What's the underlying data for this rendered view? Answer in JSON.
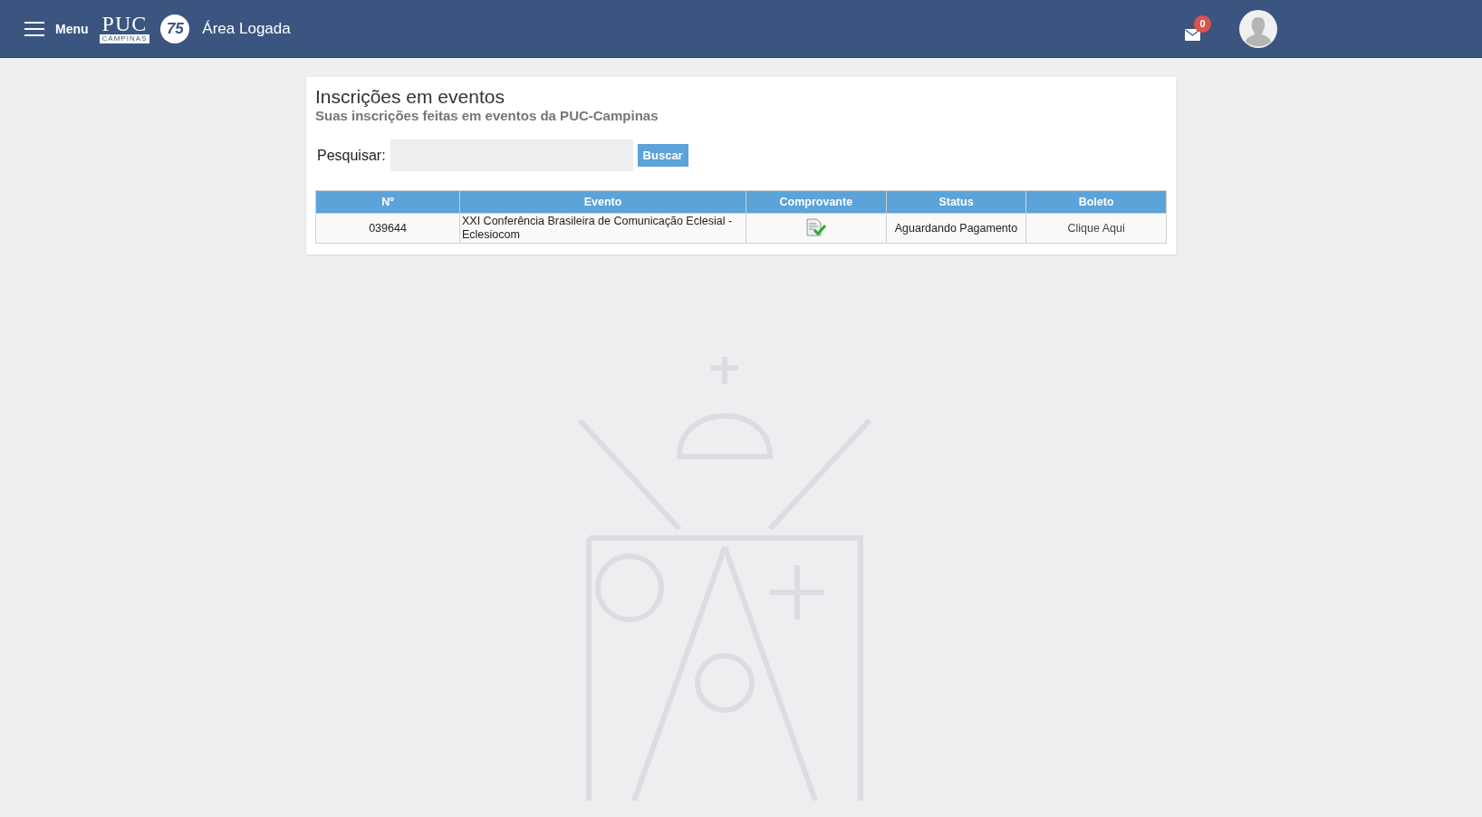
{
  "header": {
    "menu_label": "Menu",
    "logo": {
      "name": "PUC",
      "sub": "CAMPINAS",
      "badge": "75"
    },
    "title": "Área Logada",
    "notifications": {
      "count": "0"
    }
  },
  "page": {
    "title": "Inscrições em eventos",
    "subtitle": "Suas inscrições feitas em eventos da PUC-Campinas"
  },
  "search": {
    "label": "Pesquisar:",
    "button": "Buscar"
  },
  "table": {
    "columns": [
      "Nº",
      "Evento",
      "Comprovante",
      "Status",
      "Boleto"
    ],
    "rows": [
      {
        "number": "039644",
        "event": "XXI Conferência Brasileira de Comunicação Eclesial - Eclesiocom",
        "has_receipt": true,
        "status": "Aguardando Pagamento",
        "boleto": "Clique Aqui"
      }
    ]
  }
}
